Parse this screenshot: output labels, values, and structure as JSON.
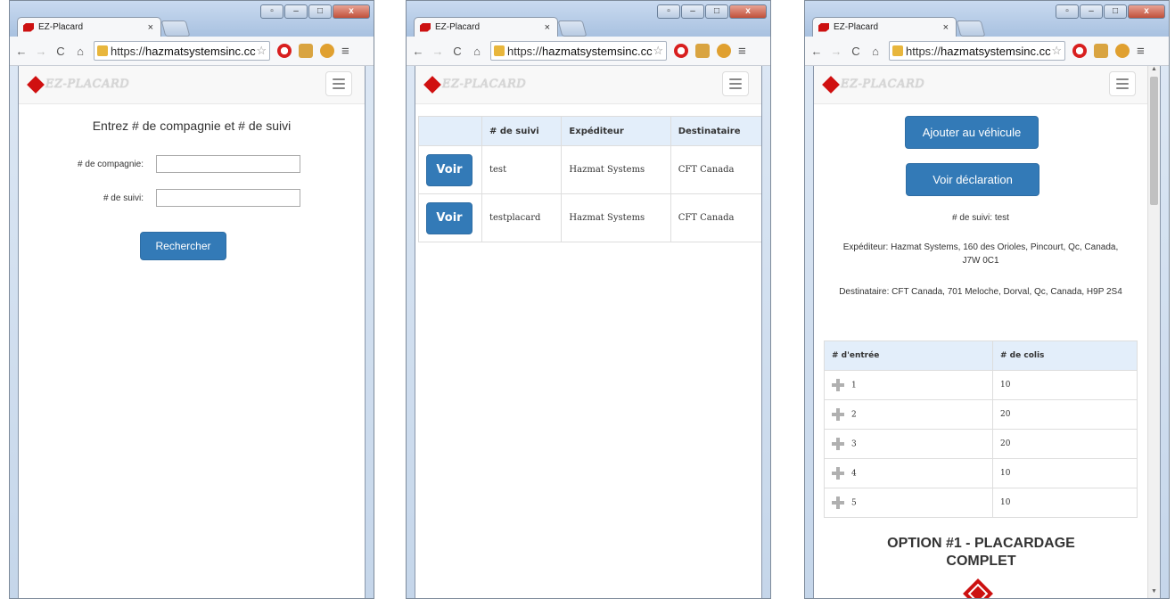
{
  "browser": {
    "tab_title": "EZ-Placard",
    "tab_close": "×",
    "url_scheme": "https://",
    "url_host": "hazmatsystemsinc.cc"
  },
  "site": {
    "brand": "EZ-PLACARD"
  },
  "screen1": {
    "heading": "Entrez # de compagnie et # de suivi",
    "company_label": "# de compagnie:",
    "company_value": "",
    "tracking_label": "# de suivi:",
    "tracking_value": "",
    "search_button": "Rechercher"
  },
  "screen2": {
    "columns": [
      "",
      "# de suivi",
      "Expéditeur",
      "Destinataire"
    ],
    "rows": [
      {
        "action": "Voir",
        "tracking": "test",
        "shipper": "Hazmat Systems",
        "consignee": "CFT Canada"
      },
      {
        "action": "Voir",
        "tracking": "testplacard",
        "shipper": "Hazmat Systems",
        "consignee": "CFT Canada"
      }
    ]
  },
  "screen3": {
    "add_vehicle_button": "Ajouter au véhicule",
    "view_declaration_button": "Voir déclaration",
    "tracking_info": "# de suivi: test",
    "shipper_info": "Expéditeur: Hazmat Systems, 160 des Orioles, Pincourt, Qc, Canada, J7W 0C1",
    "consignee_info": "Destinataire: CFT Canada, 701 Meloche, Dorval, Qc, Canada, H9P 2S4",
    "columns": [
      "# d'entrée",
      "# de colis"
    ],
    "rows": [
      {
        "entry": "1",
        "packages": "10"
      },
      {
        "entry": "2",
        "packages": "20"
      },
      {
        "entry": "3",
        "packages": "20"
      },
      {
        "entry": "4",
        "packages": "10"
      },
      {
        "entry": "5",
        "packages": "10"
      }
    ],
    "option_title": "OPTION #1 - PLACARDAGE COMPLET"
  }
}
